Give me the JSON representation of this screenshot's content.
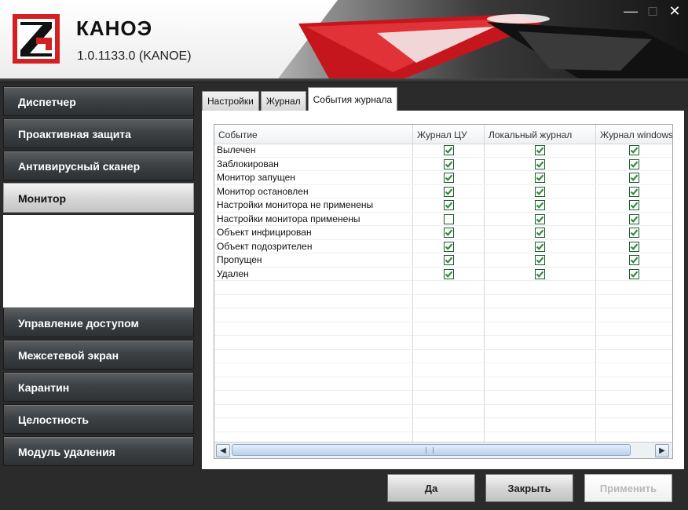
{
  "window": {
    "app_name": "КАНОЭ",
    "version": "1.0.1133.0  (KANOE)",
    "minimize": "—",
    "maximize": "□",
    "close": "✕"
  },
  "sidebar": {
    "items": [
      {
        "label": "Диспетчер"
      },
      {
        "label": "Проактивная защита"
      },
      {
        "label": "Антивирусный сканер"
      },
      {
        "label": "Монитор",
        "active": true
      },
      {
        "label": "Управление доступом"
      },
      {
        "label": "Межсетевой экран"
      },
      {
        "label": "Карантин"
      },
      {
        "label": "Целостность"
      },
      {
        "label": "Модуль удаления"
      }
    ]
  },
  "tabs": [
    {
      "label": "Настройки"
    },
    {
      "label": "Журнал"
    },
    {
      "label": "События журнала",
      "active": true
    }
  ],
  "table": {
    "columns": [
      "Событие",
      "Журнал ЦУ",
      "Локальный журнал",
      "Журнал windows"
    ],
    "rows": [
      {
        "event": "Вылечен",
        "checks": [
          true,
          true,
          true
        ]
      },
      {
        "event": "Заблокирован",
        "checks": [
          true,
          true,
          true
        ]
      },
      {
        "event": "Монитор запущен",
        "checks": [
          true,
          true,
          true
        ]
      },
      {
        "event": "Монитор остановлен",
        "checks": [
          true,
          true,
          true
        ]
      },
      {
        "event": "Настройки монитора не применены",
        "checks": [
          true,
          true,
          true
        ]
      },
      {
        "event": "Настройки монитора применены",
        "checks": [
          false,
          true,
          true
        ]
      },
      {
        "event": "Объект инфицирован",
        "checks": [
          true,
          true,
          true
        ]
      },
      {
        "event": "Объект подозрителен",
        "checks": [
          true,
          true,
          true
        ]
      },
      {
        "event": "Пропущен",
        "checks": [
          true,
          true,
          true
        ]
      },
      {
        "event": "Удален",
        "checks": [
          true,
          true,
          true
        ]
      }
    ],
    "scroll_left": "◀",
    "scroll_right": "▶"
  },
  "buttons": {
    "ok": "Да",
    "close": "Закрыть",
    "apply": "Применить"
  },
  "colors": {
    "accent_red": "#d42020",
    "checkbox_green": "#2e8b3a"
  }
}
